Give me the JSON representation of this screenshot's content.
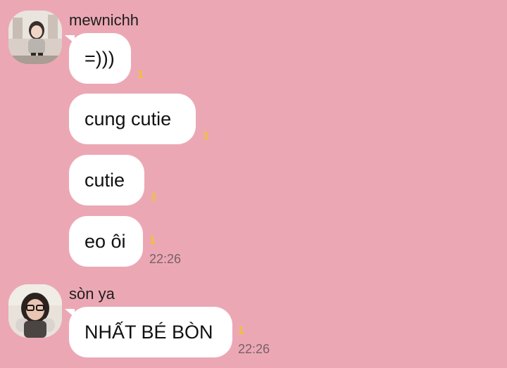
{
  "groups": [
    {
      "sender": "mewnichh",
      "avatar_icon": "user-avatar-girl-icon",
      "messages": [
        {
          "text": "=)))",
          "unread": "1",
          "time": ""
        },
        {
          "text": "cung cutie",
          "unread": "1",
          "time": ""
        },
        {
          "text": "cutie",
          "unread": "1",
          "time": ""
        },
        {
          "text": "eo ôi",
          "unread": "1",
          "time": "22:26"
        }
      ]
    },
    {
      "sender": "sòn ya",
      "avatar_icon": "user-avatar-glasses-icon",
      "messages": [
        {
          "text": "NHẤT BÉ BÒN",
          "unread": "1",
          "time": "22:26"
        }
      ]
    }
  ],
  "colors": {
    "background": "#eba8b4",
    "bubble": "#ffffff",
    "unread": "#f2c230",
    "time": "#7a6067"
  }
}
